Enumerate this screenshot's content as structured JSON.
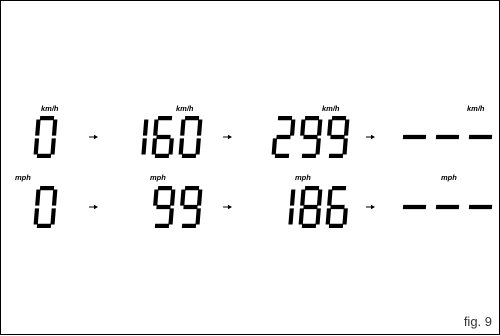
{
  "rows": [
    {
      "id": "kmh",
      "unit": "km/h",
      "readings": [
        "0",
        "160",
        "299",
        "---"
      ]
    },
    {
      "id": "mph",
      "unit": "mph",
      "readings": [
        "0",
        "99",
        "186",
        "---"
      ]
    }
  ],
  "arrow_icon": "arrow-right-icon",
  "figure_label": "fig. 9",
  "colors": {
    "segment": "#000000",
    "background": "#ffffff",
    "caption": "#333333"
  }
}
